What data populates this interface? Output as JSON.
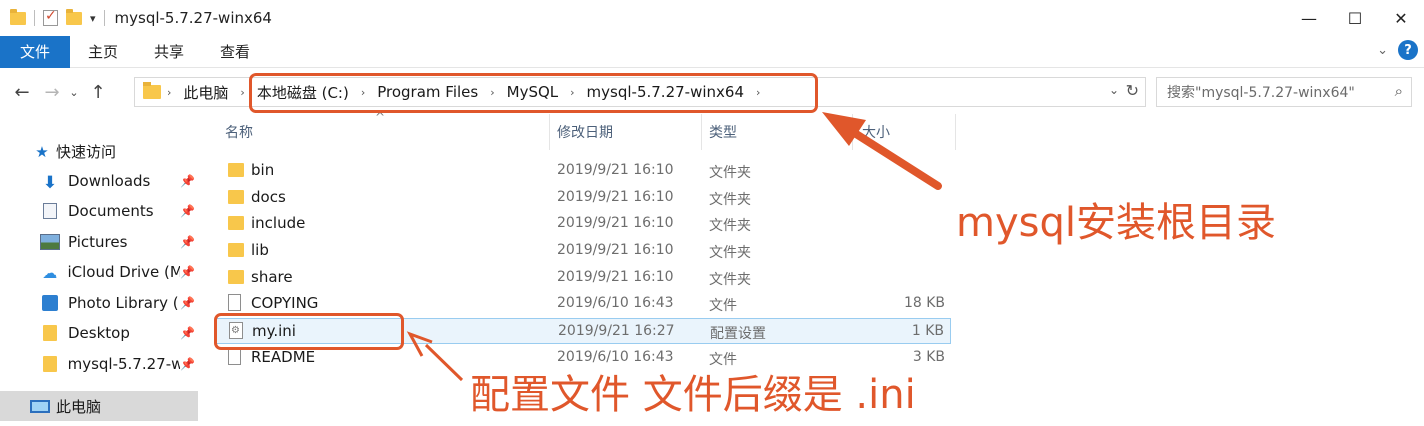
{
  "window": {
    "title": "mysql-5.7.27-winx64",
    "minimize_glyph": "—",
    "maximize_glyph": "☐",
    "close_glyph": "✕"
  },
  "ribbon": {
    "tabs": [
      "文件",
      "主页",
      "共享",
      "查看"
    ],
    "expand_glyph": "⌄",
    "help_glyph": "?"
  },
  "nav": {
    "back_glyph": "←",
    "forward_glyph": "→",
    "recent_glyph": "⌄",
    "up_glyph": "↑"
  },
  "address": {
    "crumbs": [
      "此电脑",
      "本地磁盘 (C:)",
      "Program Files",
      "MySQL",
      "mysql-5.7.27-winx64"
    ],
    "sep_glyph": "›",
    "dropdown_glyph": "⌄",
    "refresh_glyph": "↻"
  },
  "search": {
    "placeholder": "搜索\"mysql-5.7.27-winx64\"",
    "icon_glyph": "⌕"
  },
  "sidebar": {
    "items": [
      {
        "label": "快速访问",
        "icon": "star-icon",
        "glyph": "★",
        "pinned": false
      },
      {
        "label": "Downloads",
        "icon": "download-icon",
        "glyph": "⬇",
        "pinned": true
      },
      {
        "label": "Documents",
        "icon": "document-icon",
        "glyph": "",
        "pinned": true
      },
      {
        "label": "Pictures",
        "icon": "pictures-icon",
        "glyph": "",
        "pinned": true
      },
      {
        "label": "iCloud Drive (M",
        "icon": "cloud-icon",
        "glyph": "☁",
        "pinned": true
      },
      {
        "label": "Photo Library (",
        "icon": "photo-library-icon",
        "glyph": "",
        "pinned": true
      },
      {
        "label": "Desktop",
        "icon": "folder-icon",
        "glyph": "",
        "pinned": true
      },
      {
        "label": "mysql-5.7.27-w",
        "icon": "folder-icon",
        "glyph": "",
        "pinned": true
      },
      {
        "label": "此电脑",
        "icon": "this-pc-icon",
        "glyph": "",
        "pinned": false
      }
    ],
    "pin_glyph": "📌"
  },
  "columns": {
    "name": "名称",
    "date": "修改日期",
    "type": "类型",
    "size": "大小",
    "sort_glyph": "^"
  },
  "files": [
    {
      "name": "bin",
      "date": "2019/9/21 16:10",
      "type": "文件夹",
      "size": "",
      "icon": "folder-icon"
    },
    {
      "name": "docs",
      "date": "2019/9/21 16:10",
      "type": "文件夹",
      "size": "",
      "icon": "folder-icon"
    },
    {
      "name": "include",
      "date": "2019/9/21 16:10",
      "type": "文件夹",
      "size": "",
      "icon": "folder-icon"
    },
    {
      "name": "lib",
      "date": "2019/9/21 16:10",
      "type": "文件夹",
      "size": "",
      "icon": "folder-icon"
    },
    {
      "name": "share",
      "date": "2019/9/21 16:10",
      "type": "文件夹",
      "size": "",
      "icon": "folder-icon"
    },
    {
      "name": "COPYING",
      "date": "2019/6/10 16:43",
      "type": "文件",
      "size": "18 KB",
      "icon": "file-icon"
    },
    {
      "name": "my.ini",
      "date": "2019/9/21 16:27",
      "type": "配置设置",
      "size": "1 KB",
      "icon": "config-file-icon"
    },
    {
      "name": "README",
      "date": "2019/6/10 16:43",
      "type": "文件",
      "size": "3 KB",
      "icon": "file-icon"
    }
  ],
  "annotations": {
    "root_note": "mysql安装根目录",
    "config_note": "配置文件 文件后缀是 .ini",
    "color": "#e0572b"
  },
  "colors": {
    "accent": "#1a73c8",
    "folder": "#f8c74b",
    "selection_border": "#99ccf0"
  }
}
